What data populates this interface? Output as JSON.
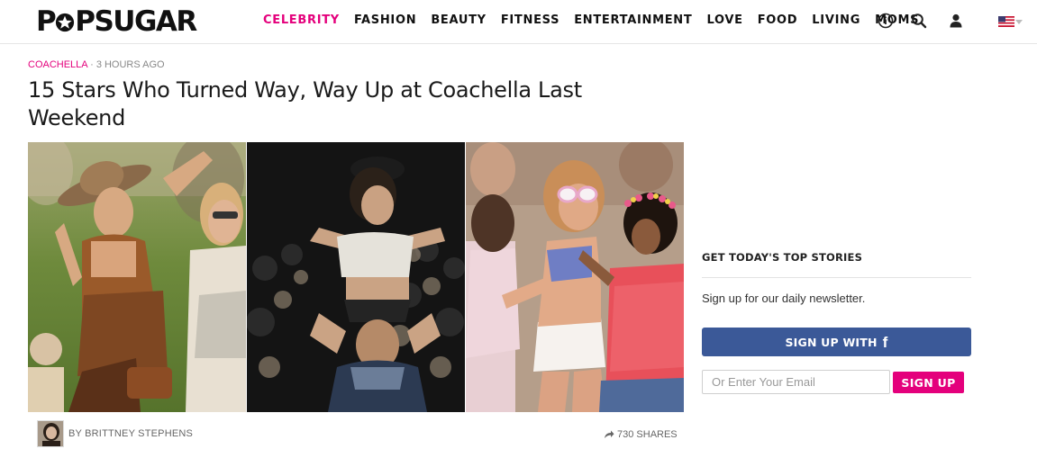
{
  "brand": {
    "logo_text_left": "P",
    "logo_text_right": "PSUGAR",
    "accent_color": "#e4007c",
    "facebook_color": "#3b5998"
  },
  "nav": {
    "items": [
      {
        "label": "CELEBRITY",
        "active": true
      },
      {
        "label": "FASHION",
        "active": false
      },
      {
        "label": "BEAUTY",
        "active": false
      },
      {
        "label": "FITNESS",
        "active": false
      },
      {
        "label": "ENTERTAINMENT",
        "active": false
      },
      {
        "label": "LOVE",
        "active": false
      },
      {
        "label": "FOOD",
        "active": false
      },
      {
        "label": "LIVING",
        "active": false
      },
      {
        "label": "MOMS",
        "active": false
      }
    ],
    "icons": [
      "info-icon",
      "search-icon",
      "user-icon",
      "us-flag-icon"
    ]
  },
  "article": {
    "category": "COACHELLA",
    "separator": " · ",
    "time": "3 HOURS AGO",
    "headline": "15 Stars Who Turned Way, Way Up at Coachella Last Weekend",
    "byline": "BY BRITTNEY STEPHENS",
    "shares": "730 SHARES"
  },
  "sidebar": {
    "title": "GET TODAY'S TOP STORIES",
    "subtitle": "Sign up for our daily newsletter.",
    "facebook_button": "SIGN UP WITH",
    "email_placeholder": "Or Enter Your Email",
    "signup_button": "SIGN UP"
  }
}
